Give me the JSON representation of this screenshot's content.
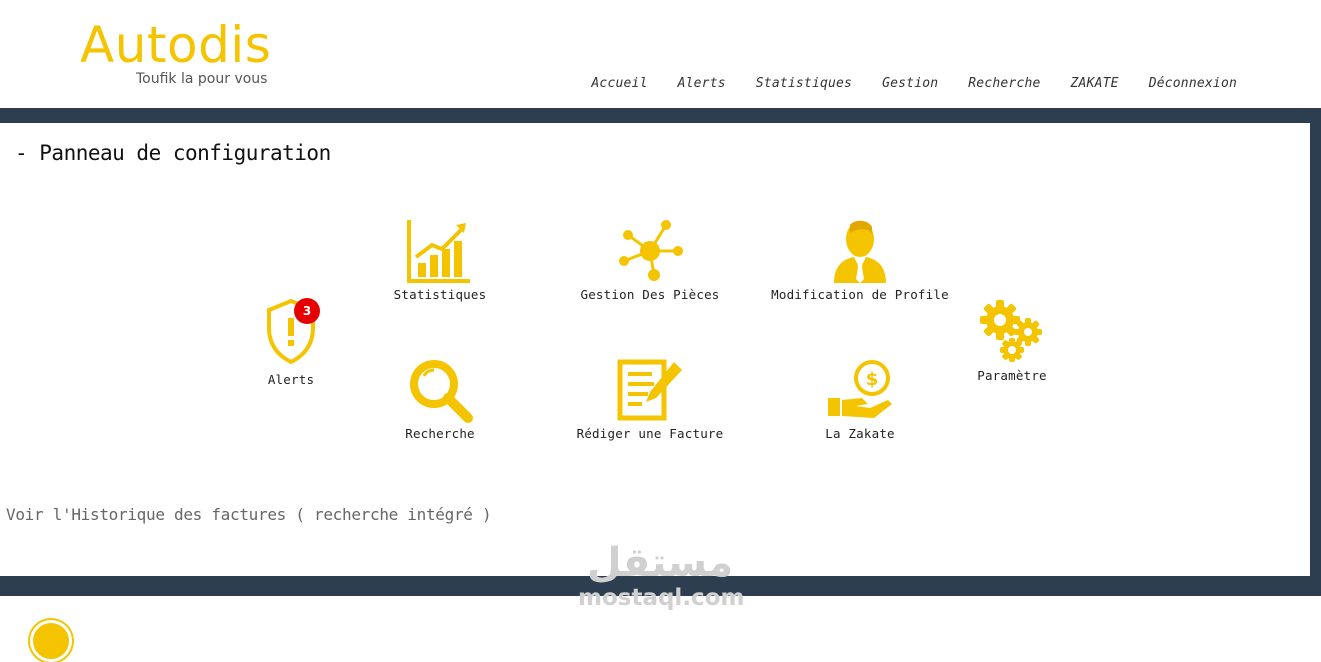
{
  "brand": {
    "name": "Autodis",
    "tagline": "Toufik la pour vous"
  },
  "nav": {
    "items": [
      {
        "label": "Accueil"
      },
      {
        "label": "Alerts"
      },
      {
        "label": "Statistiques"
      },
      {
        "label": "Gestion"
      },
      {
        "label": "Recherche"
      },
      {
        "label": "ZAKATE"
      },
      {
        "label": "Déconnexion"
      }
    ]
  },
  "panel": {
    "title": "- Panneau de configuration",
    "tiles": {
      "alerts": {
        "label": "Alerts",
        "badge": "3",
        "icon": "shield-alert-icon"
      },
      "statistiques": {
        "label": "Statistiques",
        "icon": "bar-chart-icon"
      },
      "gestion": {
        "label": "Gestion Des Pièces",
        "icon": "network-icon"
      },
      "profile": {
        "label": "Modification de Profile",
        "icon": "user-icon"
      },
      "parametre": {
        "label": "Paramètre",
        "icon": "gears-icon"
      },
      "recherche": {
        "label": "Recherche",
        "icon": "search-icon"
      },
      "facture": {
        "label": "Rédiger une Facture",
        "icon": "invoice-edit-icon"
      },
      "zakate": {
        "label": "La Zakate",
        "icon": "hand-coin-icon"
      }
    },
    "history_link": "Voir l'Historique des factures ( recherche intégré )"
  },
  "watermark": {
    "arabic": "مستقل",
    "latin": "mostaql.com"
  },
  "colors": {
    "accent": "#f5c400",
    "band": "#2c3e50",
    "badge": "#e60000"
  }
}
